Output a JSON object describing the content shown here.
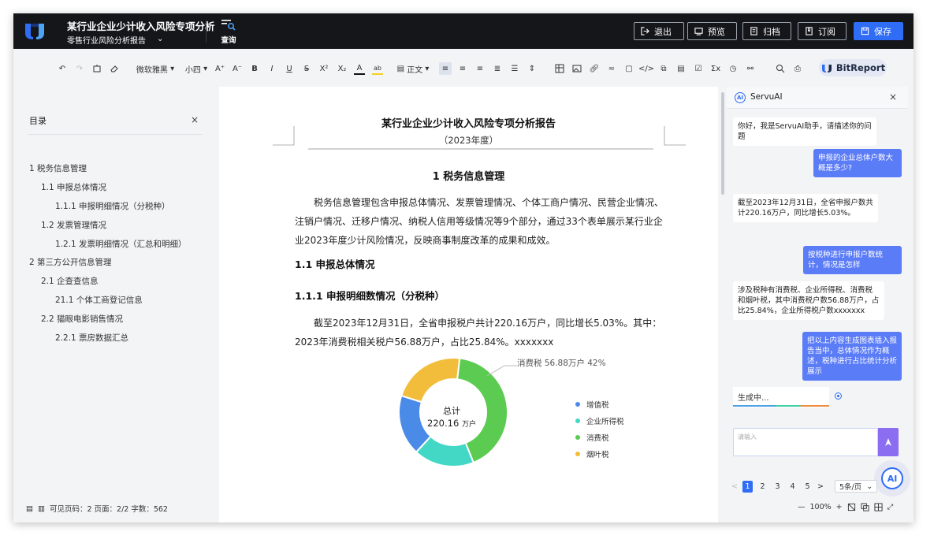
{
  "header": {
    "doc_title": "某行业企业少计收入风险专项分析",
    "doc_subtitle": "零售行业风险分析报告",
    "query_label": "查询",
    "buttons": {
      "exit": "退出",
      "preview": "预览",
      "archive": "归档",
      "subscribe": "订阅",
      "save": "保存"
    }
  },
  "toolbar": {
    "font_family": "微软雅黑",
    "font_size": "小四",
    "paragraph_style": "正文",
    "brand": "BitReport"
  },
  "toc": {
    "title": "目录",
    "items": [
      "1 税务信息管理",
      "1.1 申报总体情况",
      "1.1.1 申报明细情况（分税种）",
      "1.2 发票管理情况",
      "1.2.1 发票明细情况（汇总和明细）",
      "2 第三方公开信息管理",
      "2.1 企查查信息",
      "21.1 个体工商登记信息",
      "2.2 猫眼电影销售情况",
      "2.2.1 票房数据汇总"
    ],
    "footer": "可见页码：2 页面：2/2 字数：562"
  },
  "document": {
    "title": "某行业企业少计收入风险专项分析报告",
    "year": "（2023年度）",
    "section1": "1 税务信息管理",
    "para1": "税务信息管理包含申报总体情况、发票管理情况、个体工商户情况、民营企业情况、注销户情况、迁移户情况、纳税人信用等级情况等9个部分，通过33个表单展示某行业企业2023年度少计风险情况，反映商事制度改革的成果和成效。",
    "section1_1": "1.1 申报总体情况",
    "section1_1_1": "1.1.1 申报明细数情况（分税种）",
    "para2": "截至2023年12月31日，全省申报税户共计220.16万户，同比增长5.03%。其中：2023年消费税相关税户56.88万户，占比25.84%。xxxxxxx",
    "callout": "消费税  56.88万户  42%",
    "center_label": "总计",
    "center_value": "220.16",
    "center_unit": "万户"
  },
  "chart_data": {
    "type": "pie",
    "categories": [
      "增值税",
      "企业所得税",
      "消费税",
      "烟叶税"
    ],
    "values": [
      0.18,
      0.18,
      0.42,
      0.22
    ],
    "colors": [
      "#4b8be8",
      "#43d8c6",
      "#5ccb52",
      "#f2bd3a"
    ],
    "legend_position": "right"
  },
  "chat": {
    "title": "ServuAI",
    "messages": [
      {
        "role": "bot",
        "text": "你好，我是ServuAI助手，请描述你的问题"
      },
      {
        "role": "user",
        "text": "申报的企业总体户数大概是多少?"
      },
      {
        "role": "bot",
        "text": "截至2023年12月31日，全省申报户数共计220.16万户，同比增长5.03%。"
      },
      {
        "role": "user",
        "text": "按税种进行申报户数统计，情况是怎样"
      },
      {
        "role": "bot",
        "text": "涉及税种有消费税、企业所得税、消费税和烟叶税，其中消费税户数56.88万户，占比25.84%，企业所得税户数xxxxxxx"
      },
      {
        "role": "user",
        "text": "把以上内容生成图表插入报告当中，总体情况作为概述，税种进行占比统计分析展示"
      }
    ],
    "generating": "生成中...",
    "input_placeholder": "请输入",
    "fab_label": "AI"
  },
  "pager": {
    "prev": "<",
    "pages": [
      "1",
      "2",
      "3",
      "4",
      "5"
    ],
    "next": ">",
    "page_size": "5条/页"
  },
  "zoom": {
    "level": "100%"
  },
  "colors": {
    "accent": "#2f6df6",
    "topbar": "#14161a",
    "user_bubble": "#5b7cf7"
  }
}
